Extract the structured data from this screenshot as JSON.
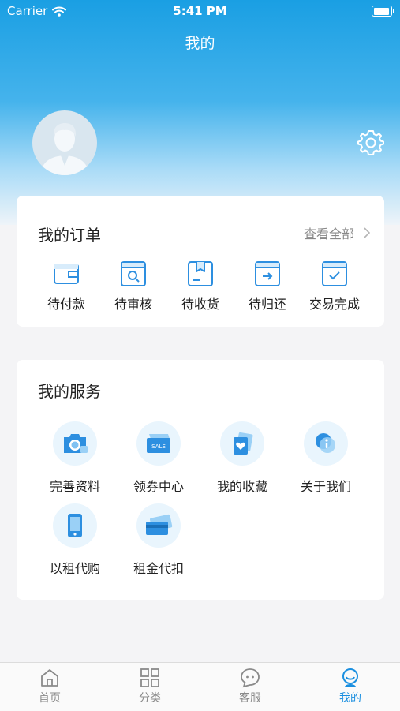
{
  "status_bar": {
    "carrier": "Carrier",
    "time": "5:41 PM"
  },
  "nav": {
    "title": "我的"
  },
  "orders": {
    "title": "我的订单",
    "view_all": "查看全部",
    "items": [
      {
        "label": "待付款",
        "icon": "wallet-icon"
      },
      {
        "label": "待审核",
        "icon": "review-icon"
      },
      {
        "label": "待收货",
        "icon": "package-icon"
      },
      {
        "label": "待归还",
        "icon": "return-icon"
      },
      {
        "label": "交易完成",
        "icon": "complete-icon"
      }
    ]
  },
  "services": {
    "title": "我的服务",
    "items": [
      {
        "label": "完善资料",
        "icon": "camera-profile-icon"
      },
      {
        "label": "领券中心",
        "icon": "coupon-icon"
      },
      {
        "label": "我的收藏",
        "icon": "favorite-icon"
      },
      {
        "label": "关于我们",
        "icon": "info-icon"
      },
      {
        "label": "以租代购",
        "icon": "phone-icon"
      },
      {
        "label": "租金代扣",
        "icon": "card-icon"
      }
    ],
    "coupon_text": "SALE"
  },
  "tabbar": {
    "items": [
      {
        "label": "首页",
        "icon": "home-icon"
      },
      {
        "label": "分类",
        "icon": "grid-icon"
      },
      {
        "label": "客服",
        "icon": "chat-icon"
      },
      {
        "label": "我的",
        "icon": "profile-icon",
        "active": true
      }
    ]
  },
  "colors": {
    "accent": "#1a8fe0",
    "header": "#1a9fe3",
    "icon_blue": "#2d8fe0"
  }
}
